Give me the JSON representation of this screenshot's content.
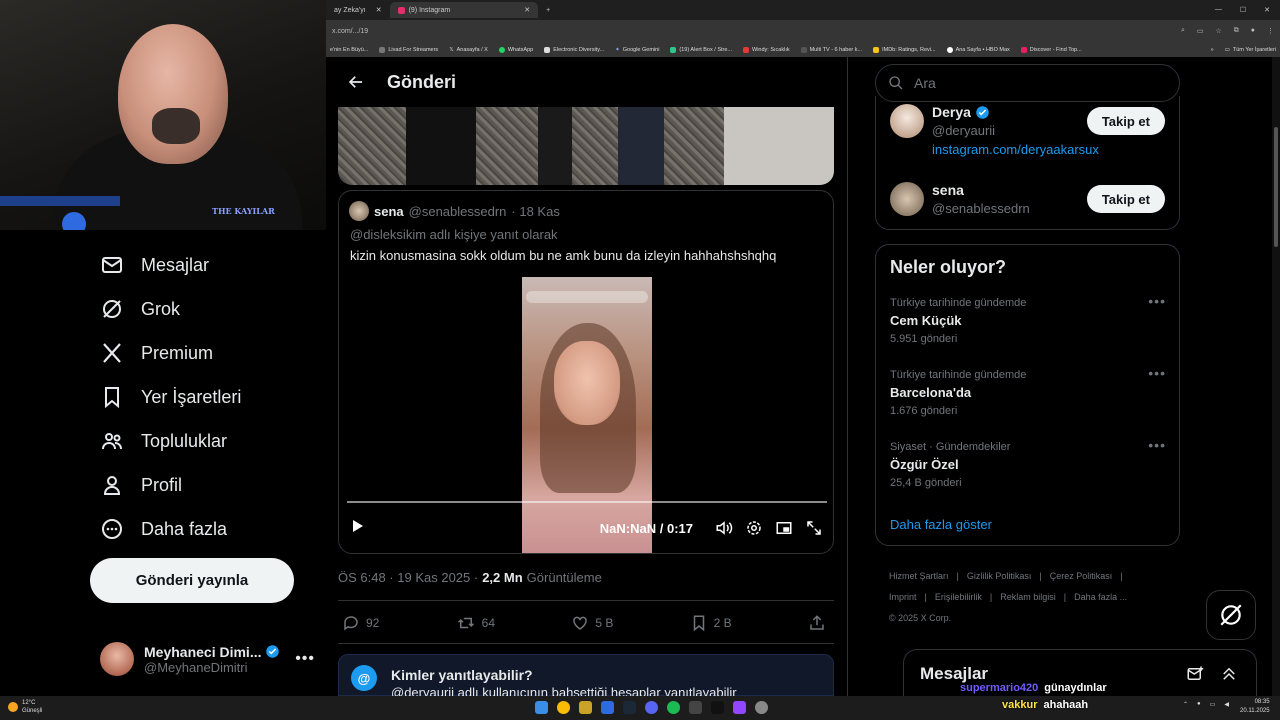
{
  "browser": {
    "tabs": [
      {
        "label": "ay Zeka'yı",
        "active": false
      },
      {
        "label": "(9) Instagram",
        "active": true
      },
      {
        "label": "+",
        "active": false
      }
    ],
    "url": "x.com/.../19",
    "bookmarks": [
      "e'nin En Büyü...",
      "Livad For Streamers",
      "Anasayfa / X",
      "WhatsApp",
      "Electronic Diversity...",
      "Google Gemini",
      "(19) Alert Box / Stre...",
      "Windy: Sıcaklık",
      "Multi TV - 6 haber k...",
      "IMDb: Ratings, Revi...",
      "Ana Sayfa • HBO Max",
      "Discover - Find Top...",
      "Tüm Yer İşaretleri"
    ]
  },
  "webcam": {
    "logo_text": "THE KAYILAR"
  },
  "nav": {
    "items": [
      {
        "label": "Mesajlar",
        "icon": "envelope-icon"
      },
      {
        "label": "Grok",
        "icon": "grok-icon"
      },
      {
        "label": "Premium",
        "icon": "x-logo-icon"
      },
      {
        "label": "Yer İşaretleri",
        "icon": "bookmark-icon"
      },
      {
        "label": "Topluluklar",
        "icon": "people-icon"
      },
      {
        "label": "Profil",
        "icon": "person-icon"
      },
      {
        "label": "Daha fazla",
        "icon": "more-circle-icon"
      }
    ],
    "post_button": "Gönderi yayınla",
    "account": {
      "name": "Meyhaneci Dimi...",
      "handle": "@MeyhaneDimitri"
    }
  },
  "main": {
    "title": "Gönderi",
    "quote": {
      "name": "sena",
      "handle": "@senablessedrn",
      "date": "· 18 Kas",
      "reply_to": "@disleksikim adlı kişiye yanıt olarak",
      "text": "kizin konusmasina sokk oldum bu ne amk bunu da izleyin hahhahshshqhq",
      "video_time": "NaN:NaN / 0:17"
    },
    "meta": {
      "time": "ÖS 6:48 · 19 Kas 2025 ·",
      "views": "2,2 Mn",
      "views_label": "Görüntüleme"
    },
    "actions": {
      "replies": "92",
      "reposts": "64",
      "likes": "5 B",
      "bookmarks": "2 B"
    },
    "who_can_reply": {
      "at": "@",
      "title": "Kimler yanıtlayabilir?",
      "subtitle": "@deryaurii adlı kullanıcının bahsettiği hesaplar yanıtlayabilir"
    }
  },
  "right": {
    "search_placeholder": "Ara",
    "who_to_follow": [
      {
        "name": "Derya",
        "handle": "@deryaurii",
        "link": "instagram.com/deryaakarsux",
        "button": "Takip et"
      },
      {
        "name": "sena",
        "handle": "@senablessedrn",
        "button": "Takip et"
      }
    ],
    "trends_title": "Neler oluyor?",
    "trends": [
      {
        "context": "Türkiye tarihinde gündemde",
        "title": "Cem Küçük",
        "count": "5.951 gönderi"
      },
      {
        "context": "Türkiye tarihinde gündemde",
        "title": "Barcelona'da",
        "count": "1.676 gönderi"
      },
      {
        "context": "Siyaset · Gündemdekiler",
        "title": "Özgür Özel",
        "count": "25,4 B gönderi"
      }
    ],
    "show_more": "Daha fazla göster",
    "footer": [
      "Hizmet Şartları",
      "|",
      "Gizlilik Politikası",
      "|",
      "Çerez Politikası",
      "|",
      "Imprint",
      "|",
      "Erişilebilirlik",
      "|",
      "Reklam bilgisi",
      "|",
      "Daha fazla ...",
      "© 2025 X Corp."
    ],
    "messages_title": "Mesajlar"
  },
  "chat_overlay": [
    {
      "user": "supermario420",
      "msg": "günaydınlar",
      "color": "#6f5cff"
    },
    {
      "user": "vakkur",
      "msg": "ahahaah",
      "color": "#ffe14d"
    }
  ],
  "taskbar": {
    "weather_temp": "12°C",
    "weather_desc": "Güneşli",
    "time": "08:35",
    "date": "20.11.2025"
  }
}
